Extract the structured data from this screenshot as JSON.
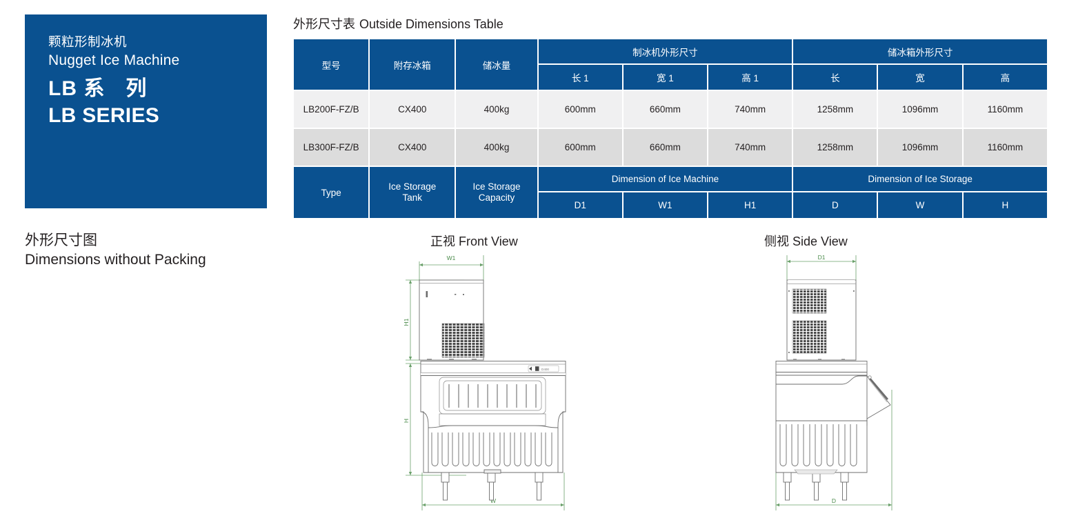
{
  "hero": {
    "title_cn": "颗粒形制冰机",
    "title_en": "Nugget Ice Machine",
    "series_cn_a": "LB 系",
    "series_cn_b": "列",
    "series_en": "LB SERIES",
    "bg_color": "#0a5190"
  },
  "table": {
    "title_cn": "外形尺寸表",
    "title_en": "Outside Dimensions Table",
    "header_color": "#0a5190",
    "row_colors": [
      "#f0f0f1",
      "#dcdcdc"
    ],
    "header_cn": {
      "model": "型号",
      "ice_tank": "附存冰箱",
      "ice_capacity": "储冰量",
      "group_machine": "制冰机外形尺寸",
      "group_storage": "储冰箱外形尺寸",
      "sub": [
        "长 1",
        "宽 1",
        "高 1",
        "长",
        "宽",
        "高"
      ]
    },
    "rows": [
      {
        "model": "LB200F-FZ/B",
        "ice_tank": "CX400",
        "ice_capacity": "400kg",
        "d1": "600mm",
        "w1": "660mm",
        "h1": "740mm",
        "d": "1258mm",
        "w": "1096mm",
        "h": "1160mm"
      },
      {
        "model": "LB300F-FZ/B",
        "ice_tank": "CX400",
        "ice_capacity": "400kg",
        "d1": "600mm",
        "w1": "660mm",
        "h1": "740mm",
        "d": "1258mm",
        "w": "1096mm",
        "h": "1160mm"
      }
    ],
    "footer_en": {
      "model": "Type",
      "ice_tank_l1": "Ice Storage",
      "ice_tank_l2": "Tank",
      "ice_capacity_l1": "Ice Storage",
      "ice_capacity_l2": "Capacity",
      "group_machine": "Dimension of Ice Machine",
      "group_storage": "Dimension of Ice Storage",
      "sub": [
        "D1",
        "W1",
        "H1",
        "D",
        "W",
        "H"
      ]
    }
  },
  "drawings": {
    "caption_cn": "外形尺寸图",
    "caption_en": "Dimensions without Packing",
    "front": {
      "title_cn": "正视",
      "title_en": "Front View",
      "dim_width_top": "W1",
      "dim_height_top": "H1",
      "dim_height_bottom": "H",
      "dim_width_bottom": "W",
      "panel_badge": "D400"
    },
    "side": {
      "title_cn": "侧视",
      "title_en": "Side View",
      "dim_depth_top": "D1",
      "dim_depth_bottom": "D"
    },
    "dim_line_color": "#6aa06a",
    "outline_color": "#595959"
  }
}
